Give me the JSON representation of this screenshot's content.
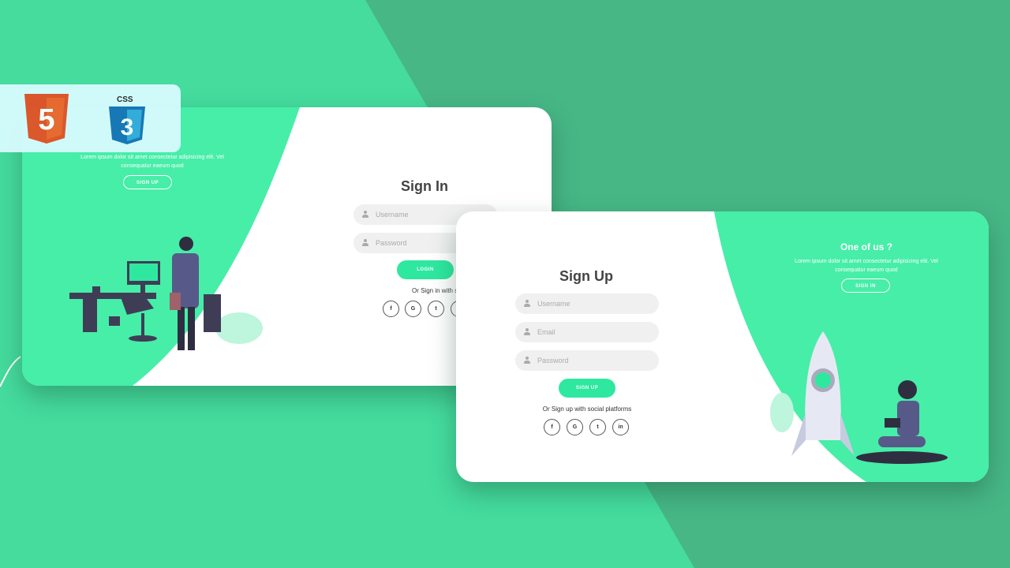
{
  "colors": {
    "background": "#47b786",
    "background_light": "#45dc9e",
    "accent": "#2ee8a0",
    "panel": "#46eea8"
  },
  "badge": {
    "icons": [
      "html5-icon",
      "css3-icon"
    ],
    "css_label": "CSS"
  },
  "signin": {
    "title": "Sign In",
    "username_placeholder": "Username",
    "password_placeholder": "Password",
    "login_label": "LOGIN",
    "social_text": "Or Sign in with social platf",
    "socials": [
      "f",
      "G",
      "t"
    ],
    "panel_text_line1": "Lorem ipsum dolor sit amet consectetur adipisicing elit. Vel",
    "panel_text_line2": "consequatur eaeum quod",
    "signup_label": "SIGN UP"
  },
  "signup": {
    "title": "Sign Up",
    "username_placeholder": "Username",
    "email_placeholder": "Email",
    "password_placeholder": "Password",
    "signup_label": "SIGN UP",
    "social_text": "Or Sign up with social platforms",
    "socials": [
      "f",
      "G",
      "t",
      "in"
    ],
    "panel_title": "One of us ?",
    "panel_text_line1": "Lorem ipsum dolor sit amet consectetur adipisicing elit. Vel",
    "panel_text_line2": "consequatur eaeum quod",
    "signin_label": "SIGN IN"
  }
}
